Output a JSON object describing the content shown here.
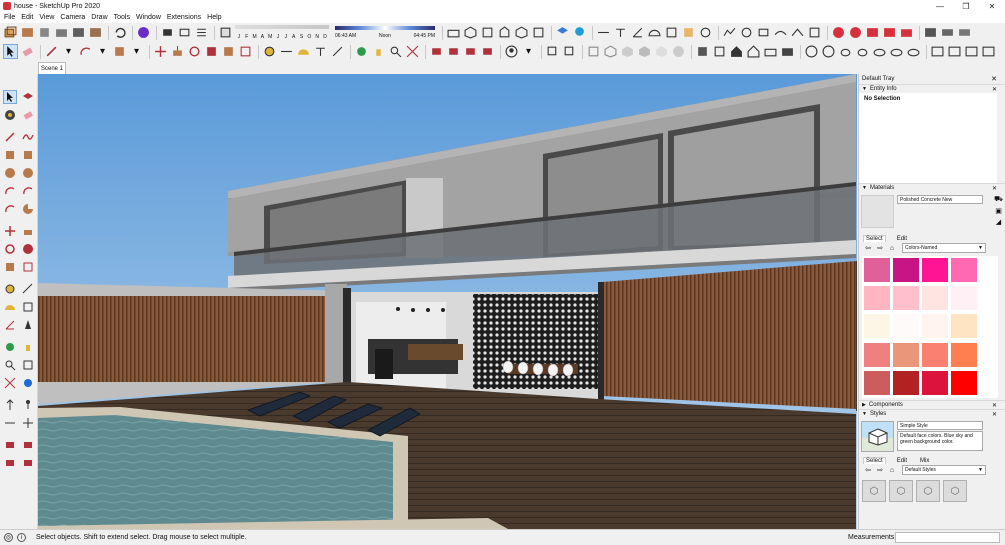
{
  "window": {
    "title": "house - SketchUp Pro 2020",
    "minimize": "—",
    "maximize": "❐",
    "close": "✕"
  },
  "menu": [
    "File",
    "Edit",
    "View",
    "Camera",
    "Draw",
    "Tools",
    "Window",
    "Extensions",
    "Help"
  ],
  "shadows": {
    "months": [
      "J",
      "F",
      "M",
      "A",
      "M",
      "J",
      "J",
      "A",
      "S",
      "O",
      "N",
      "D"
    ],
    "time_start": "06:43 AM",
    "time_mid": "Noon",
    "time_end": "04:45 PM"
  },
  "scene_tab": "Scene 1",
  "tray": {
    "title": "Default Tray",
    "entity_info": {
      "header": "Entity Info",
      "selection": "No Selection"
    },
    "materials": {
      "header": "Materials",
      "name": "Polished Concrete New",
      "tabs": [
        "Select",
        "Edit"
      ],
      "library": "Colors-Named",
      "swatch_colors": [
        "#e0609a",
        "#c71585",
        "#ff1493",
        "#ff69b4",
        "#ffb6c1",
        "#ffc0cb",
        "#ffe4e1",
        "#fff0f5",
        "#fdf5e6",
        "#fffafa",
        "#fff5ee",
        "#ffe4c4",
        "#f08080",
        "#e9967a",
        "#fa8072",
        "#ff7f50",
        "#cd5c5c",
        "#b22222",
        "#dc143c",
        "#ff0000"
      ]
    },
    "components": {
      "header": "Components"
    },
    "styles": {
      "header": "Styles",
      "name": "Simple Style",
      "description": "Default face colors. Blue sky and green background color.",
      "tabs": [
        "Select",
        "Edit",
        "Mix"
      ],
      "library": "Default Styles"
    }
  },
  "status": {
    "message": "Select objects. Shift to extend select. Drag mouse to select multiple.",
    "measurements_label": "Measurements"
  }
}
